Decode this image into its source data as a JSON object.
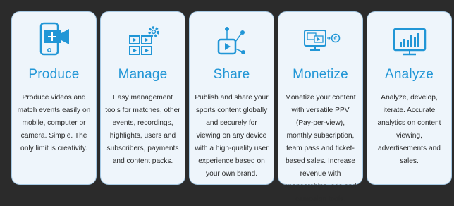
{
  "cards": [
    {
      "title": "Produce",
      "icon": "video-camera-phone-icon",
      "description": "Produce videos and match events easily on mobile, computer or camera. Simple. The only limit is creativity."
    },
    {
      "title": "Manage",
      "icon": "manage-playlist-gear-icon",
      "description": "Easy management tools for matches, other events, recordings, highlights, users and subscribers, payments and content packs."
    },
    {
      "title": "Share",
      "icon": "share-network-icon",
      "description": "Publish and share your sports content globally and securely for viewing on any device with a high-quality user experience based on your own brand."
    },
    {
      "title": "Monetize",
      "icon": "monetize-screen-euro-icon",
      "description": "Monetize your content with versatile PPV (Pay-per-view), monthly subscription, team pass and ticket-based sales. Increase revenue with sponsorships, ads and campaign tools."
    },
    {
      "title": "Analyze",
      "icon": "analytics-bar-chart-icon",
      "description": "Analyze, develop, iterate. Accurate analytics on content viewing, advertisements and sales."
    }
  ],
  "colors": {
    "accent": "#2196d6",
    "card_bg": "#eef5fb",
    "card_border": "#a8cbe6",
    "page_bg": "#2b2b2b",
    "text": "#2a2a2a"
  }
}
